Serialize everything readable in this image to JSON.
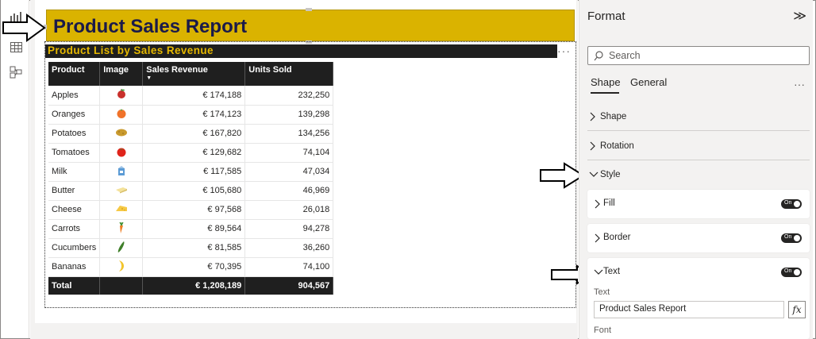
{
  "report": {
    "title": "Product Sales Report",
    "subtitle": "Product List by Sales Revenue",
    "more": "···"
  },
  "table": {
    "columns": [
      "Product",
      "Image",
      "Sales Revenue",
      "Units Sold"
    ],
    "sort_indicator": "▼",
    "rows": [
      {
        "product": "Apples",
        "image": "apple-icon",
        "revenue": "€ 174,188",
        "units": "232,250"
      },
      {
        "product": "Oranges",
        "image": "orange-icon",
        "revenue": "€ 174,123",
        "units": "139,298"
      },
      {
        "product": "Potatoes",
        "image": "potato-icon",
        "revenue": "€ 167,820",
        "units": "134,256"
      },
      {
        "product": "Tomatoes",
        "image": "tomato-icon",
        "revenue": "€ 129,682",
        "units": "74,104"
      },
      {
        "product": "Milk",
        "image": "milk-icon",
        "revenue": "€ 117,585",
        "units": "47,034"
      },
      {
        "product": "Butter",
        "image": "butter-icon",
        "revenue": "€ 105,680",
        "units": "46,969"
      },
      {
        "product": "Cheese",
        "image": "cheese-icon",
        "revenue": "€ 97,568",
        "units": "26,018"
      },
      {
        "product": "Carrots",
        "image": "carrot-icon",
        "revenue": "€ 89,564",
        "units": "94,278"
      },
      {
        "product": "Cucumbers",
        "image": "cucumber-icon",
        "revenue": "€ 81,585",
        "units": "36,260"
      },
      {
        "product": "Bananas",
        "image": "banana-icon",
        "revenue": "€ 70,395",
        "units": "74,100"
      }
    ],
    "total": {
      "label": "Total",
      "revenue": "€ 1,208,189",
      "units": "904,567"
    }
  },
  "format_pane": {
    "title": "Format",
    "collapse": "≫",
    "search_placeholder": "Search",
    "tabs": [
      "Shape",
      "General"
    ],
    "more": "···",
    "sections": {
      "shape": "Shape",
      "rotation": "Rotation",
      "style": "Style",
      "fill": "Fill",
      "border": "Border",
      "text": "Text"
    },
    "toggle_label": "On",
    "text_field_label": "Text",
    "text_value": "Product Sales Report",
    "fx": "fx",
    "font_label": "Font"
  },
  "colors": {
    "title_bg": "#dab300",
    "title_text": "#1a1a4a",
    "subtitle_text": "#e6b800",
    "header_bg": "#1f1f1f"
  }
}
